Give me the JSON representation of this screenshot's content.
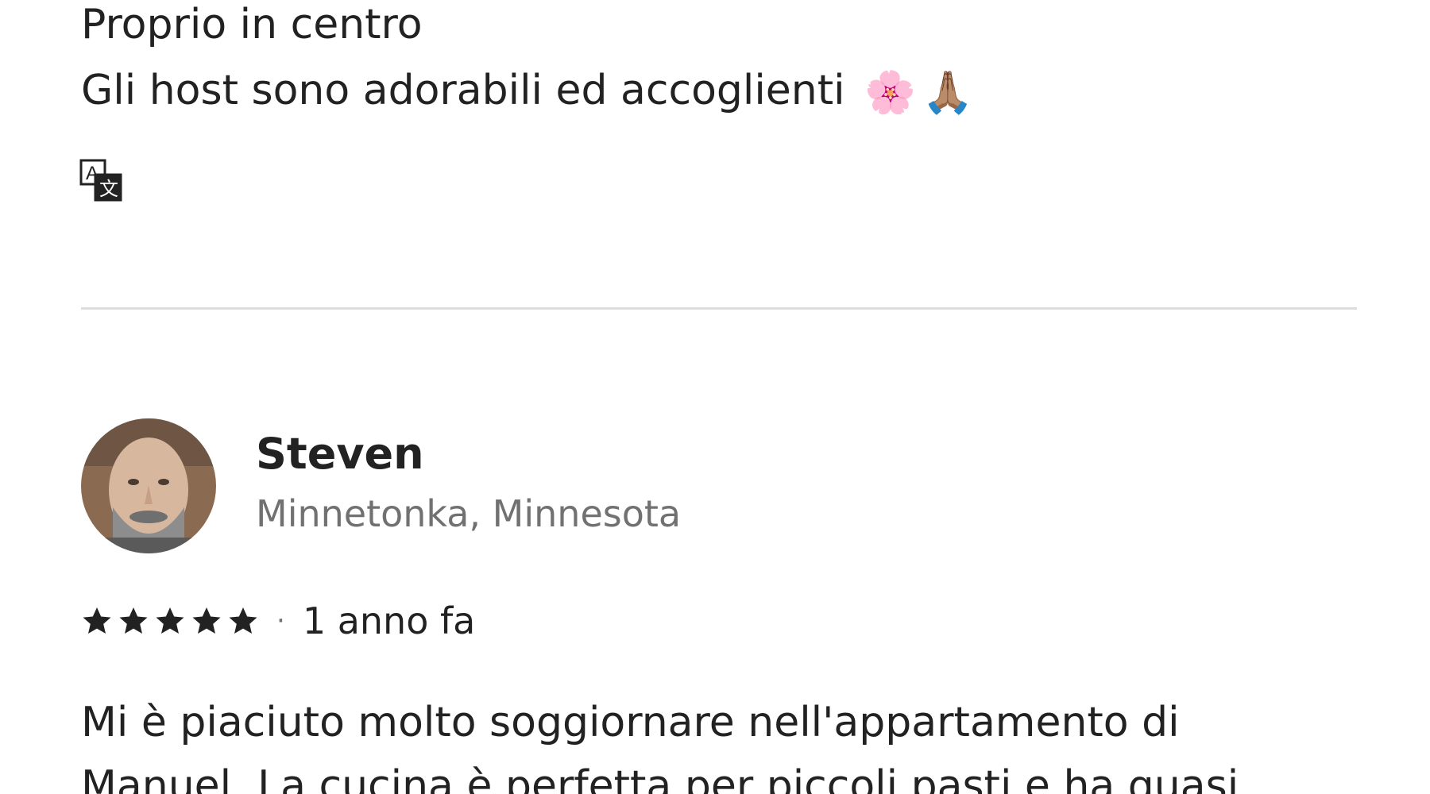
{
  "previous_review": {
    "line1": "Proprio in centro",
    "line2": "Gli host sono adorabili ed accoglienti",
    "emoji1": "🌸",
    "emoji2": "🙏🏽",
    "translate_icon": "translate-icon"
  },
  "review": {
    "reviewer_name": "Steven",
    "reviewer_location": "Minnetonka, Minnesota",
    "rating": 5,
    "rating_max": 5,
    "separator": "·",
    "date": "1 anno fa",
    "body_line1": "Mi è piaciuto molto soggiornare nell'appartamento di",
    "body_line2": "Manuel. La cucina è perfetta per piccoli pasti e ha quasi"
  },
  "colors": {
    "text_primary": "#222222",
    "text_secondary": "#717171",
    "divider": "#dddddd"
  }
}
